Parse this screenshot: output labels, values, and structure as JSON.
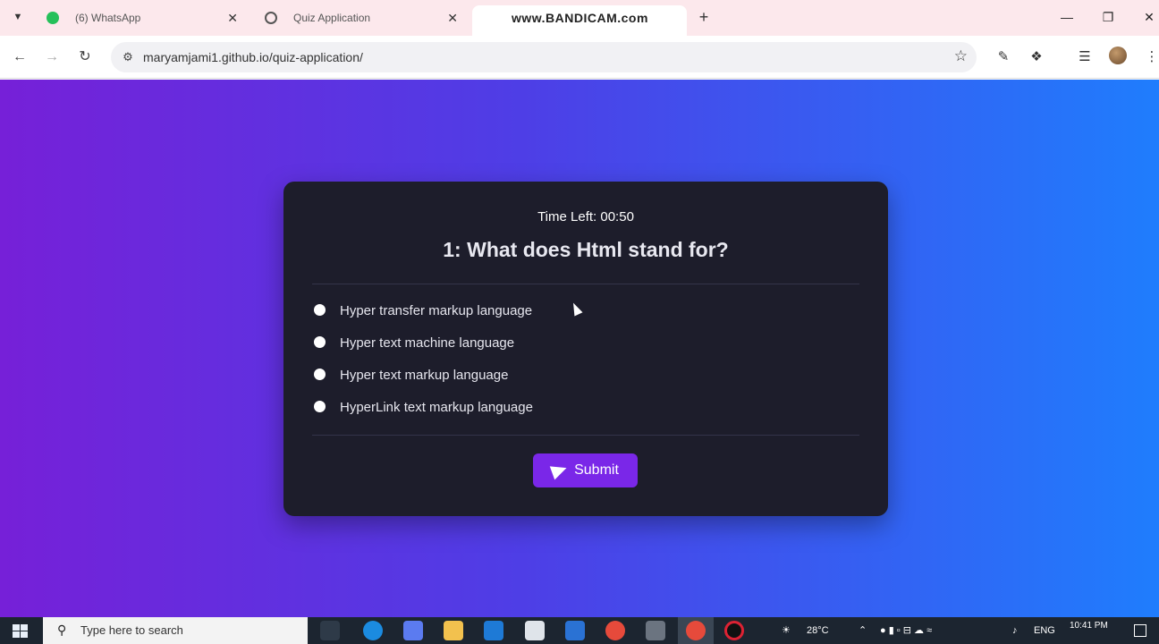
{
  "browser": {
    "tabs": [
      {
        "label": "(6) WhatsApp",
        "icon": "whatsapp-icon"
      },
      {
        "label": "Quiz Application",
        "icon": "globe-icon"
      },
      {
        "label": "www.BANDICAM.com",
        "icon": ""
      }
    ],
    "address": "maryamjami1.github.io/quiz-application/"
  },
  "quiz": {
    "timer": "Time Left: 00:50",
    "question": "1: What does Html stand for?",
    "options": [
      "Hyper transfer markup language",
      "Hyper text machine language",
      "Hyper text markup language",
      "HyperLink text markup language"
    ],
    "submit_label": "Submit"
  },
  "taskbar": {
    "search_placeholder": "Type here to search",
    "weather": "28°C",
    "language": "ENG",
    "time": "10:41 PM"
  },
  "colors": {
    "gradient_start": "#7620d8",
    "gradient_end": "#1f7dfd",
    "card_bg": "#1d1d2b",
    "submit_bg": "#7a27e8"
  }
}
